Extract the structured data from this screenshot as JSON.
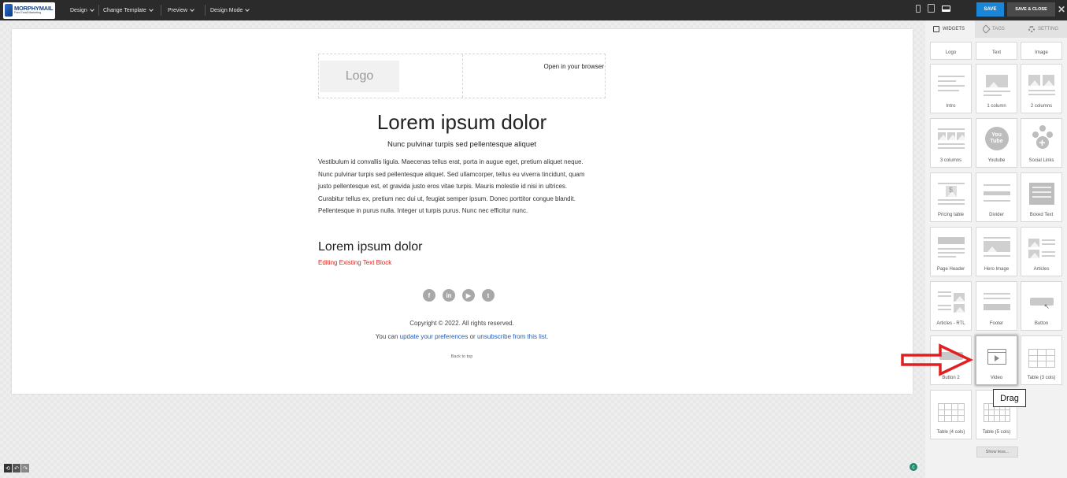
{
  "brand": {
    "name": "MORPHYMAIL",
    "tagline": "Free Email Marketing"
  },
  "menu": [
    {
      "label": "Design"
    },
    {
      "label": "Change Template"
    },
    {
      "label": "Preview"
    },
    {
      "label": "Design Mode"
    }
  ],
  "actions": {
    "save": "SAVE",
    "save_close": "SAVE & CLOSE",
    "close": "✕"
  },
  "email": {
    "logo": "Logo",
    "open_browser": "Open in your browser",
    "title": "Lorem ipsum dolor",
    "subtitle": "Nunc pulvinar turpis sed pellentesque aliquet",
    "body_lines": [
      "Vestibulum id convallis ligula. Maecenas tellus erat, porta in augue eget, pretium aliquet neque.",
      "Nunc pulvinar turpis sed pellentesque aliquet. Sed ullamcorper, tellus eu viverra tincidunt, quam",
      "justo pellentesque est, et gravida justo eros vitae turpis. Mauris molestie id nisi in ultrices.",
      "Curabitur tellus ex, pretium nec dui ut, feugiat semper ipsum. Donec porttitor congue blandit.",
      "Pellentesque in purus nulla. Integer ut turpis purus. Nunc nec efficitur nunc."
    ],
    "heading2": "Lorem ipsum dolor",
    "edit_note": "Editing Existing Text Block",
    "socials": [
      {
        "icon": "facebook-icon",
        "glyph": "f"
      },
      {
        "icon": "linkedin-icon",
        "glyph": "in"
      },
      {
        "icon": "youtube-icon",
        "glyph": "▶"
      },
      {
        "icon": "twitter-icon",
        "glyph": "t"
      }
    ],
    "copyright": "Copyright © 2022. All rights reserved.",
    "prefs_prefix": "You can ",
    "prefs_link1": "update your preferences",
    "prefs_mid": " or ",
    "prefs_link2": "unsubscribe from this list",
    "prefs_suffix": ".",
    "back_to_top": "Back to top"
  },
  "panel": {
    "tabs": [
      {
        "label": "WIDGETS",
        "icon": "widgets-icon"
      },
      {
        "label": "TAGS",
        "icon": "tag-icon"
      },
      {
        "label": "SETTING",
        "icon": "gear-icon"
      }
    ],
    "widgets": [
      {
        "label": "Logo",
        "icon": "logo-icon"
      },
      {
        "label": "Text",
        "icon": "text-icon"
      },
      {
        "label": "Image",
        "icon": "image-icon"
      },
      {
        "label": "Intro",
        "icon": "intro-icon"
      },
      {
        "label": "1 column",
        "icon": "one-column-icon"
      },
      {
        "label": "2 columns",
        "icon": "two-columns-icon"
      },
      {
        "label": "3 columns",
        "icon": "three-columns-icon"
      },
      {
        "label": "Youtube",
        "icon": "youtube-icon",
        "glyph": "You\nTube"
      },
      {
        "label": "Social Links",
        "icon": "social-links-icon"
      },
      {
        "label": "Pricing table",
        "icon": "pricing-table-icon",
        "glyph": "$"
      },
      {
        "label": "Divider",
        "icon": "divider-icon"
      },
      {
        "label": "Boxed Text",
        "icon": "boxed-text-icon"
      },
      {
        "label": "Page Header",
        "icon": "page-header-icon"
      },
      {
        "label": "Hero Image",
        "icon": "hero-image-icon"
      },
      {
        "label": "Articles",
        "icon": "articles-icon"
      },
      {
        "label": "Articles - RTL",
        "icon": "articles-rtl-icon"
      },
      {
        "label": "Footer",
        "icon": "footer-icon"
      },
      {
        "label": "Button",
        "icon": "button-icon"
      },
      {
        "label": "Button 2",
        "icon": "button2-icon"
      },
      {
        "label": "Video",
        "icon": "video-icon"
      },
      {
        "label": "Table (3 cols)",
        "icon": "table-3-cols-icon"
      },
      {
        "label": "Table (4 cols)",
        "icon": "table-4-cols-icon"
      },
      {
        "label": "Table (5 cols)",
        "icon": "table-5-cols-icon"
      }
    ],
    "show_less": "Show less...",
    "tooltip": "Drag"
  },
  "colors": {
    "accent": "#1a86d8",
    "topbar": "#2b2b2b",
    "arrow": "#e02020",
    "edit_note": "#d9251d",
    "link": "#1d5fbf"
  }
}
